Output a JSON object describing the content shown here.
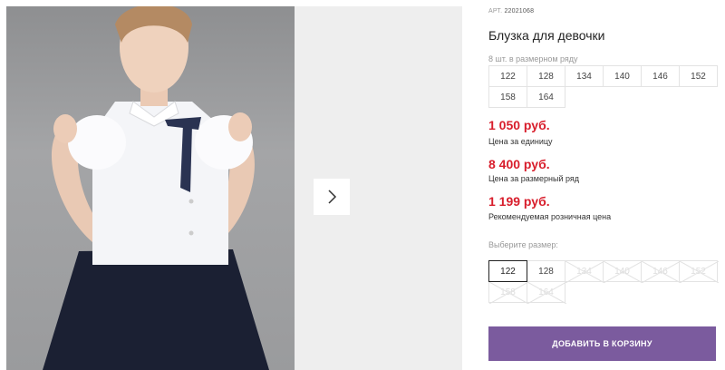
{
  "product": {
    "art_prefix": "АРТ.",
    "art_number": "22021068",
    "title": "Блузка для девочки"
  },
  "pack": {
    "label": "8 шт. в размерном ряду",
    "sizes": [
      "122",
      "128",
      "134",
      "140",
      "146",
      "152",
      "158",
      "164"
    ]
  },
  "prices": {
    "unit_price": "1 050 руб.",
    "unit_label": "Цена за единицу",
    "pack_price": "8 400 руб.",
    "pack_label": "Цена за размерный ряд",
    "retail_price": "1 199 руб.",
    "retail_label": "Рекомендуемая розничная цена",
    "price_color": "#d81e2c"
  },
  "size_select": {
    "label": "Выберите размер:",
    "options": [
      {
        "size": "122",
        "state": "selected"
      },
      {
        "size": "128",
        "state": "available"
      },
      {
        "size": "134",
        "state": "unavailable"
      },
      {
        "size": "140",
        "state": "unavailable"
      },
      {
        "size": "146",
        "state": "unavailable"
      },
      {
        "size": "152",
        "state": "unavailable"
      },
      {
        "size": "158",
        "state": "unavailable"
      },
      {
        "size": "164",
        "state": "unavailable"
      }
    ]
  },
  "cart": {
    "label": "ДОБАВИТЬ В КОРЗИНУ",
    "color": "#7b5b9e"
  },
  "gallery": {
    "next_icon": "chevron-right-icon"
  }
}
